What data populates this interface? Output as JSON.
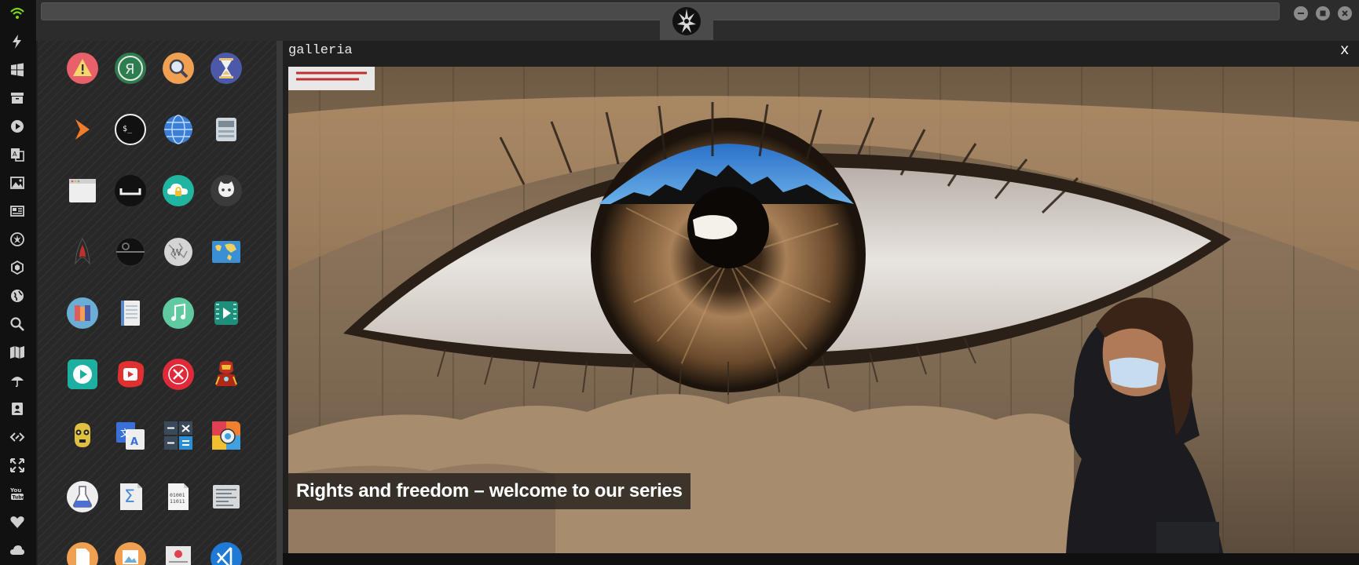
{
  "topbar": {
    "logo": "rebel-alliance-logo",
    "window_controls": [
      "minimize",
      "maximize",
      "close"
    ]
  },
  "sidebar": {
    "items": [
      {
        "icon": "wifi-icon",
        "color": "#7ed321"
      },
      {
        "icon": "lightning-icon"
      },
      {
        "icon": "windows-icon"
      },
      {
        "icon": "archive-icon"
      },
      {
        "icon": "play-circle-icon"
      },
      {
        "icon": "translate-icon"
      },
      {
        "icon": "image-icon"
      },
      {
        "icon": "newspaper-icon"
      },
      {
        "icon": "rebel-icon"
      },
      {
        "icon": "hexagon-icon"
      },
      {
        "icon": "globe-icon"
      },
      {
        "icon": "search-icon"
      },
      {
        "icon": "map-icon"
      },
      {
        "icon": "umbrella-icon"
      },
      {
        "icon": "contact-card-icon"
      },
      {
        "icon": "code-icon"
      },
      {
        "icon": "fullscreen-icon"
      },
      {
        "icon": "youtube-icon"
      },
      {
        "icon": "heart-icon"
      },
      {
        "icon": "cloud-icon"
      }
    ]
  },
  "apps": [
    {
      "name": "warning-app",
      "color": "#e05c5c"
    },
    {
      "name": "yandex-app",
      "color": "#2e7d4f"
    },
    {
      "name": "search-app",
      "color": "#f0a050"
    },
    {
      "name": "hourglass-app",
      "color": "#4a5aa8"
    },
    {
      "name": "prompt-app",
      "color": "#f07c2a"
    },
    {
      "name": "terminal-app",
      "color": "#111111"
    },
    {
      "name": "web-browser-app",
      "color": "#3a7fd5"
    },
    {
      "name": "scanner-app",
      "color": "#d0d0d0"
    },
    {
      "name": "window-app",
      "color": "#e8e8e8"
    },
    {
      "name": "spacebar-app",
      "color": "#111111"
    },
    {
      "name": "cloud-lock-app",
      "color": "#20b5a0"
    },
    {
      "name": "github-app",
      "color": "#3a3a3a"
    },
    {
      "name": "star-trek-app",
      "color": "#222222"
    },
    {
      "name": "death-star-app",
      "color": "#222222"
    },
    {
      "name": "wikipedia-app",
      "color": "#cfcfcf"
    },
    {
      "name": "world-map-app",
      "color": "#3a8fd5"
    },
    {
      "name": "books-app",
      "color": "#6aaed6"
    },
    {
      "name": "notebook-app",
      "color": "#e8e8e8"
    },
    {
      "name": "music-app",
      "color": "#5fc9a0"
    },
    {
      "name": "video-app",
      "color": "#1d8f7a"
    },
    {
      "name": "player-app",
      "color": "#1db0a0"
    },
    {
      "name": "youtube-app",
      "color": "#e03030"
    },
    {
      "name": "close-app",
      "color": "#e02a3a"
    },
    {
      "name": "iron-man-app",
      "color": "#b03020"
    },
    {
      "name": "c3po-app",
      "color": "#e0c040"
    },
    {
      "name": "translate-app",
      "color": "#3a70d5"
    },
    {
      "name": "calculator-app",
      "color": "#3a4a5a"
    },
    {
      "name": "color-picker-app",
      "color": "#f08030"
    },
    {
      "name": "chemistry-app",
      "color": "#eeeeee"
    },
    {
      "name": "sigma-app",
      "color": "#e8e8e8"
    },
    {
      "name": "binary-file-app",
      "color": "#f0f0f0"
    },
    {
      "name": "text-editor-app",
      "color": "#d8d8d8"
    },
    {
      "name": "document-app",
      "color": "#f0a050"
    },
    {
      "name": "image-viewer-app",
      "color": "#f0a050"
    },
    {
      "name": "presentation-app",
      "color": "#dddddd"
    },
    {
      "name": "vscode-app",
      "color": "#1f7ad6"
    }
  ],
  "gallery": {
    "title": "galleria",
    "close_label": "x",
    "caption": "Rights and freedom – welcome to our series"
  }
}
